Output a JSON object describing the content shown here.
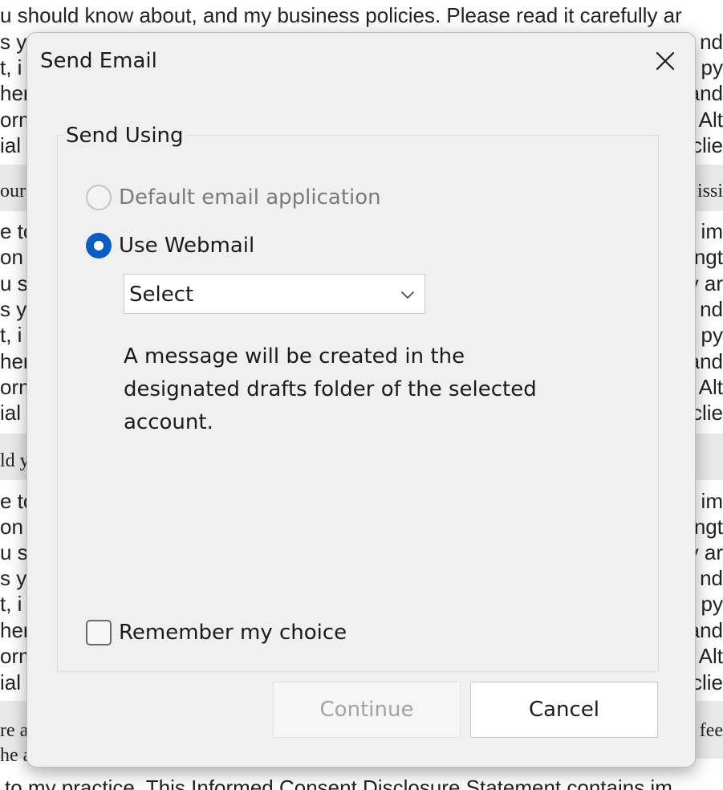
{
  "background": {
    "top_line": "u should know about, and my business policies. Please read it carefully ar",
    "bottom_line": "to my practice. This Informed Consent Disclosure Statement contains im",
    "left_fragments": [
      "s yo",
      "t, i",
      "her",
      "orm",
      "ial",
      "our",
      "e to",
      "on",
      "u sh",
      "s yo",
      "t, i",
      "her",
      "orm",
      "ial",
      "ld y",
      "e to",
      "on",
      "u sh",
      "s yo",
      "t, i",
      "her",
      "orm",
      "ial",
      "re a",
      "he a"
    ],
    "right_fragments": [
      "nd",
      "py",
      "and",
      "Alt",
      "clie",
      "issi",
      "s im",
      "ngt",
      "y ar",
      "nd",
      "py",
      "and",
      "Alt",
      "clie",
      "s im",
      "ngt",
      "y ar",
      "nd",
      "py",
      "and",
      "Alt",
      "clie",
      "fee"
    ]
  },
  "dialog": {
    "title": "Send Email",
    "group_label": "Send Using",
    "option_default": "Default email application",
    "option_webmail": "Use Webmail",
    "select_value": "Select",
    "info_text": "A message will be created in the designated drafts folder of the selected account.",
    "remember_label": "Remember my choice",
    "continue_label": "Continue",
    "cancel_label": "Cancel"
  },
  "colors": {
    "accent": "#0a5dc2",
    "dialog_bg": "#f0f0f0",
    "disabled_text": "#a3a3a3"
  }
}
